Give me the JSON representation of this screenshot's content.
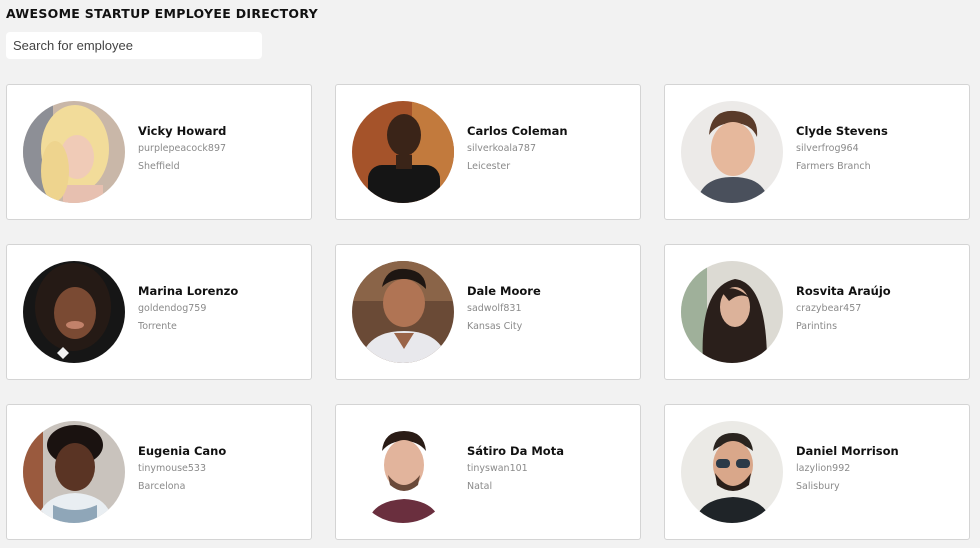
{
  "header": {
    "title": "AWESOME STARTUP EMPLOYEE DIRECTORY",
    "search_placeholder": "Search for employee"
  },
  "employees": [
    {
      "name": "Vicky Howard",
      "username": "purplepeacock897",
      "city": "Sheffield"
    },
    {
      "name": "Carlos Coleman",
      "username": "silverkoala787",
      "city": "Leicester"
    },
    {
      "name": "Clyde Stevens",
      "username": "silverfrog964",
      "city": "Farmers Branch"
    },
    {
      "name": "Marina Lorenzo",
      "username": "goldendog759",
      "city": "Torrente"
    },
    {
      "name": "Dale Moore",
      "username": "sadwolf831",
      "city": "Kansas City"
    },
    {
      "name": "Rosvita Araújo",
      "username": "crazybear457",
      "city": "Parintins"
    },
    {
      "name": "Eugenia Cano",
      "username": "tinymouse533",
      "city": "Barcelona"
    },
    {
      "name": "Sátiro Da Mota",
      "username": "tinyswan101",
      "city": "Natal"
    },
    {
      "name": "Daniel Morrison",
      "username": "lazylion992",
      "city": "Salisbury"
    }
  ]
}
